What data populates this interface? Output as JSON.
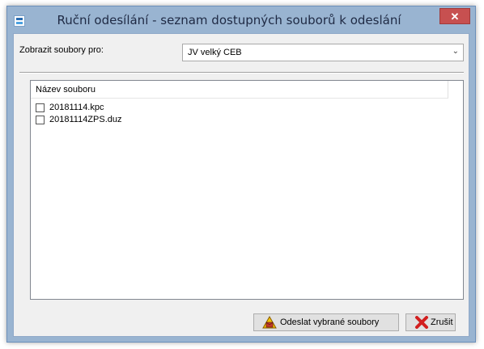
{
  "window": {
    "title": "Ruční odesílání - seznam dostupných souborů k odeslání",
    "close_glyph": "✕"
  },
  "filter": {
    "label": "Zobrazit soubory pro:",
    "selected": "JV velký CEB",
    "arrow_glyph": "⌄"
  },
  "file_list": {
    "header": "Název souboru",
    "items": [
      {
        "name": "20181114.kpc",
        "checked": false
      },
      {
        "name": "20181114ZPS.duz",
        "checked": false
      }
    ]
  },
  "buttons": {
    "send_label": "Odeslat vybrané soubory",
    "send_icon": "send-warning-icon",
    "cancel_label": "Zrušit",
    "cancel_icon": "red-x-icon"
  },
  "colors": {
    "window_frame": "#99b4d1",
    "close_button": "#c75050",
    "client_bg": "#f0f0f0"
  }
}
